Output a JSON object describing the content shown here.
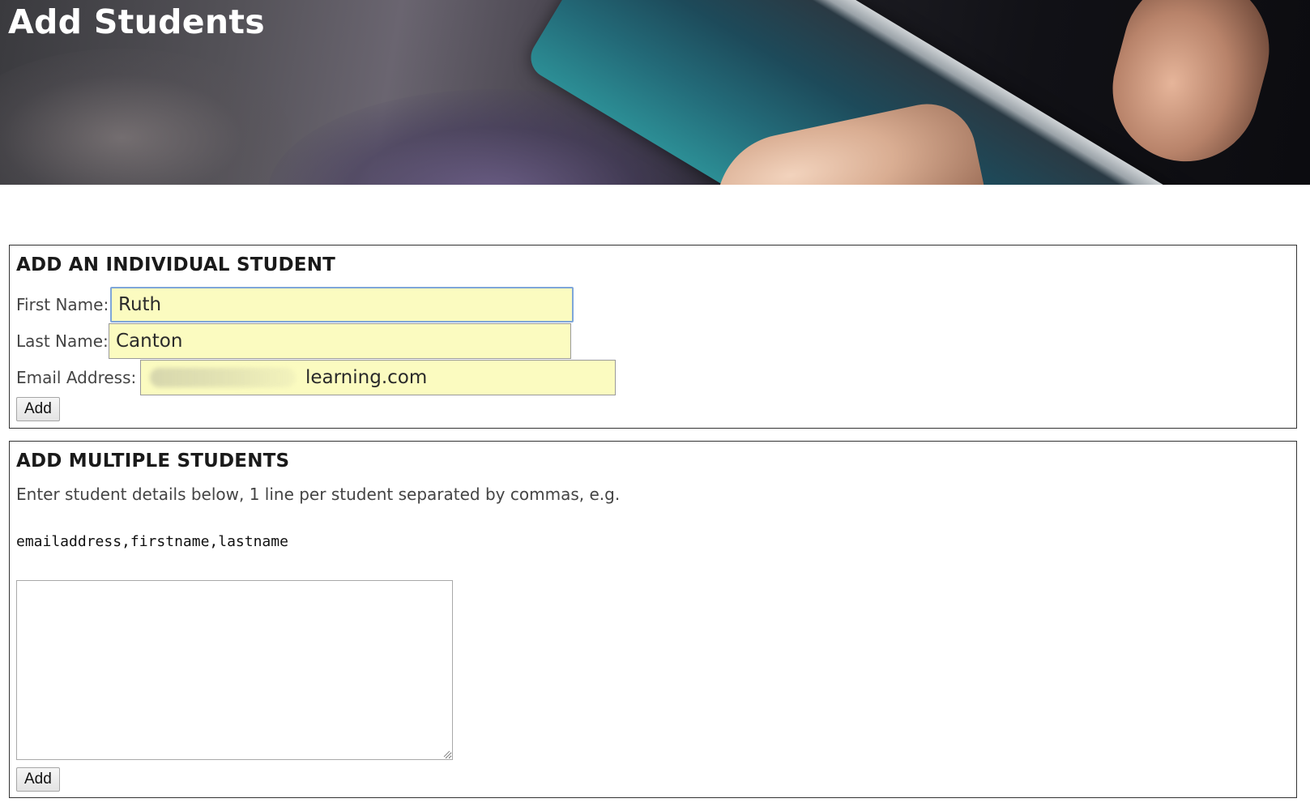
{
  "page": {
    "title": "Add Students"
  },
  "individual": {
    "heading": "ADD AN INDIVIDUAL STUDENT",
    "first_name_label": "First Name:",
    "first_name_value": "Ruth",
    "last_name_label": "Last Name:",
    "last_name_value": "Canton",
    "email_label": "Email Address:",
    "email_value": "ruth.canton@leolearning.com",
    "email_visible_suffix": "learning.com",
    "add_label": "Add"
  },
  "multiple": {
    "heading": "ADD MULTIPLE STUDENTS",
    "description": "Enter student details below, 1 line per student separated by commas, e.g.",
    "example": "emailaddress,firstname,lastname",
    "textarea_value": "",
    "add_label": "Add"
  },
  "colors": {
    "autofill_bg": "#fbfbc0",
    "focus_border": "#7fa6d9",
    "panel_border": "#333333"
  }
}
